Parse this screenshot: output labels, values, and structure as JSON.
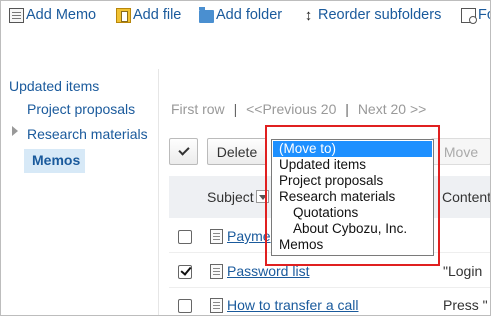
{
  "toolbar": {
    "add_memo": "Add Memo",
    "add_file": "Add file",
    "add_folder": "Add folder",
    "reorder_subfolders": "Reorder subfolders",
    "form_partial": "Fo"
  },
  "sidebar": {
    "items": [
      {
        "label": "Updated items"
      },
      {
        "label": "Project proposals"
      },
      {
        "label": "Research materials"
      },
      {
        "label": "Memos"
      }
    ]
  },
  "pager": {
    "first": "First row",
    "sep": "|",
    "previous": "<<Previous 20",
    "next": "Next 20 >>"
  },
  "actions": {
    "delete": "Delete",
    "move": "Move"
  },
  "table": {
    "headers": {
      "subject": "Subject",
      "content": "Content"
    },
    "rows": [
      {
        "title": "Payme",
        "content": "",
        "checked": false
      },
      {
        "title": "Password list",
        "content": "\"Login",
        "checked": true
      },
      {
        "title": "How to transfer a call",
        "content": "Press \"",
        "checked": false
      }
    ]
  },
  "move_to_dropdown": {
    "options": [
      {
        "label": "(Move to)",
        "selected": true,
        "indent": false
      },
      {
        "label": "Updated items",
        "selected": false,
        "indent": false
      },
      {
        "label": "Project proposals",
        "selected": false,
        "indent": false
      },
      {
        "label": "Research materials",
        "selected": false,
        "indent": false
      },
      {
        "label": "Quotations",
        "selected": false,
        "indent": true
      },
      {
        "label": "About Cybozu, Inc.",
        "selected": false,
        "indent": true
      },
      {
        "label": "Memos",
        "selected": false,
        "indent": false
      }
    ],
    "selected_color": "#1e90ff",
    "highlight_color": "#e02020"
  }
}
